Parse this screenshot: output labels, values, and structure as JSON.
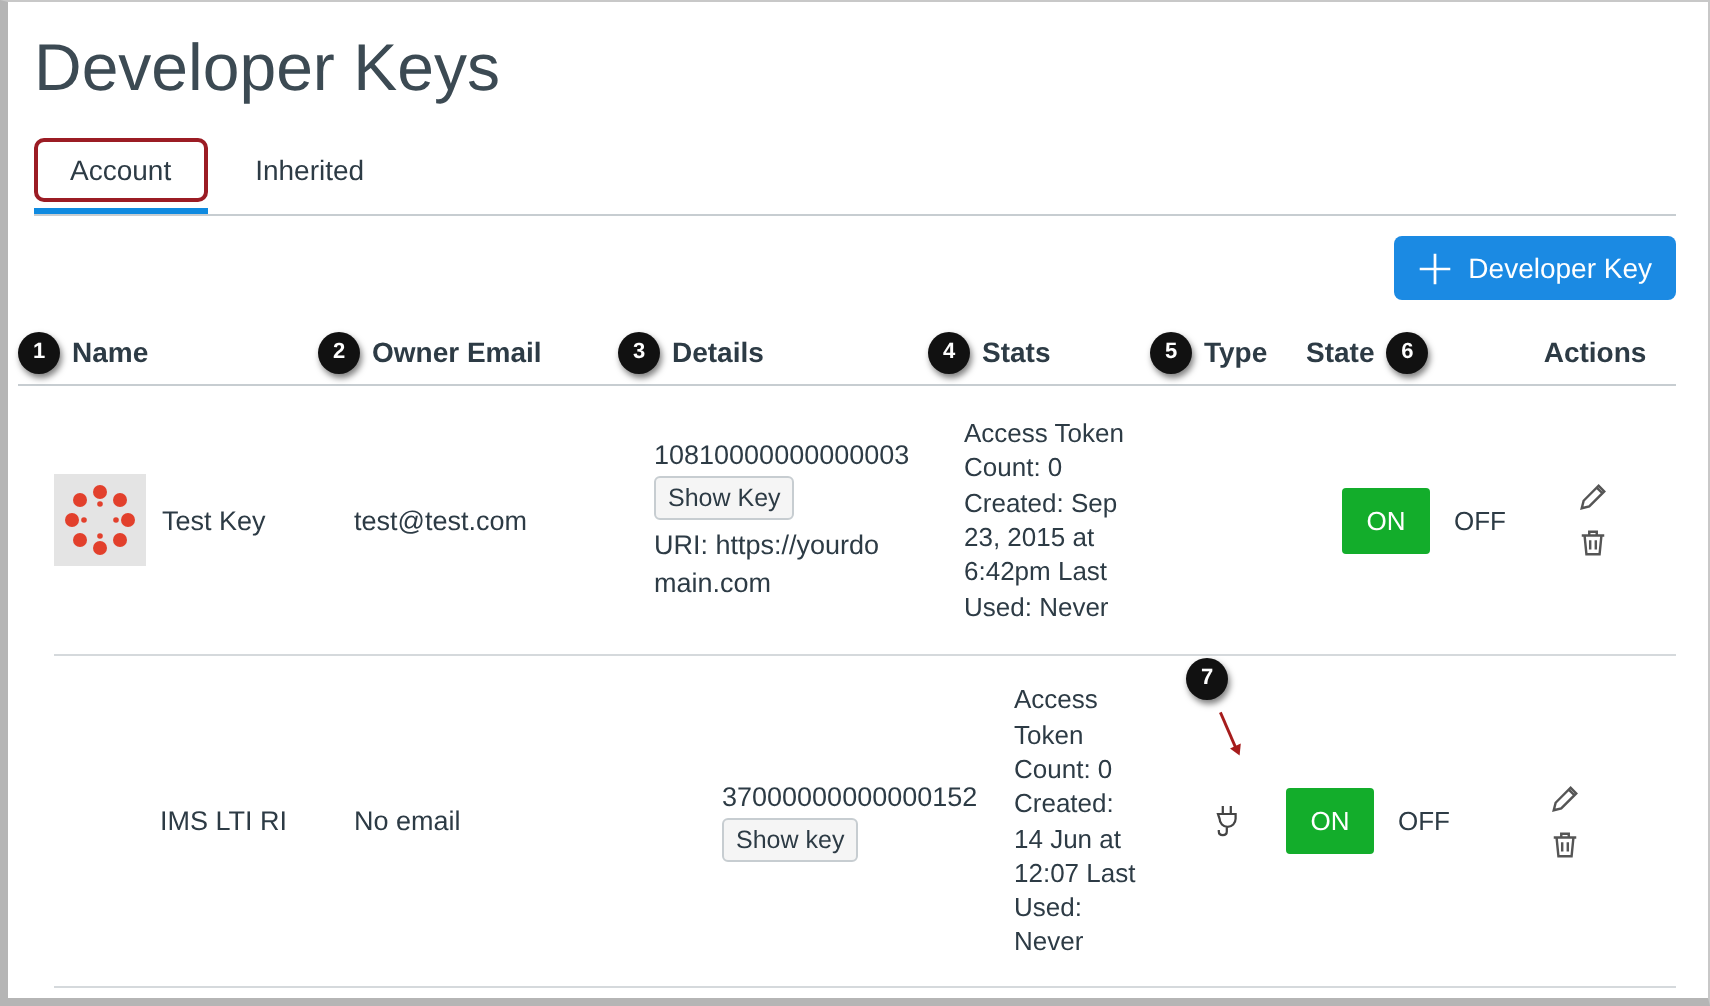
{
  "title": "Developer Keys",
  "tabs": [
    {
      "label": "Account",
      "selected": true,
      "highlighted": true
    },
    {
      "label": "Inherited",
      "selected": false,
      "highlighted": false
    }
  ],
  "add_button": {
    "label": "Developer Key"
  },
  "columns": [
    {
      "label": "Name",
      "callout": "1"
    },
    {
      "label": "Owner Email",
      "callout": "2"
    },
    {
      "label": "Details",
      "callout": "3"
    },
    {
      "label": "Stats",
      "callout": "4"
    },
    {
      "label": "Type",
      "callout": "5"
    },
    {
      "label": "State",
      "callout_after": "6"
    },
    {
      "label": "Actions"
    }
  ],
  "rows": [
    {
      "logo": true,
      "name": "Test Key",
      "email": "test@test.com",
      "key": "10810000000000003",
      "show_key": "Show Key",
      "uri": "URI: https://yourdomain.com",
      "stats": "Access Token Count: 0 Created: Sep 23, 2015 at 6:42pm Last Used: Never",
      "lti": false,
      "state_on": "ON",
      "state_off": "OFF",
      "enabled": true
    },
    {
      "logo": false,
      "name": "IMS LTI RI",
      "email": "No email",
      "key": "37000000000000152",
      "show_key": "Show key",
      "stats": "Access Token Count: 0 Created: 14 Jun at 12:07 Last Used: Never",
      "lti": true,
      "type_callout": "7",
      "state_on": "ON",
      "state_off": "OFF",
      "enabled": true
    }
  ]
}
